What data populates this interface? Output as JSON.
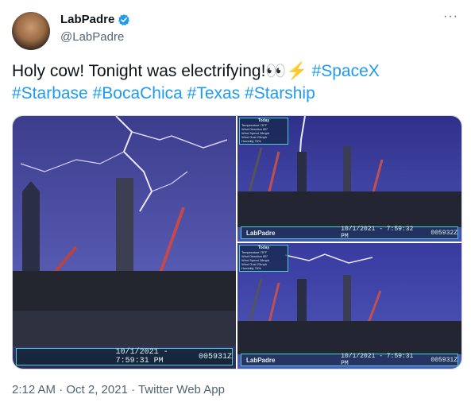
{
  "author": {
    "display_name": "LabPadre",
    "handle": "@LabPadre",
    "verified_icon": "verified-badge-icon",
    "avatar_icon": "avatar"
  },
  "menu": {
    "more_label": "···"
  },
  "tweet": {
    "text_plain": "Holy cow! Tonight was electrifying!",
    "emoji": "👀⚡",
    "hashtags": [
      "#SpaceX",
      "#Starbase",
      "#BocaChica",
      "#Texas",
      "#Starship"
    ]
  },
  "media": {
    "main": {
      "timestamp": "10/1/2021 - 7:59:31 PM",
      "code": "005931Z"
    },
    "top_right": {
      "logo": "LabPadre",
      "timestamp": "10/1/2021 - 7:59:32 PM",
      "code": "005932Z",
      "weather_title": "Today",
      "weather_lines": [
        "Temperature 75°F",
        "Wind Direction 85°",
        "Wind Speed 18mph",
        "Wind Gust 23mph",
        "Humidity 76%"
      ]
    },
    "bottom_right": {
      "logo": "LabPadre",
      "timestamp": "10/1/2021 - 7:59:31 PM",
      "code": "005931Z",
      "weather_title": "Today",
      "weather_lines": [
        "Temperature 75°F",
        "Wind Direction 85°",
        "Wind Speed 18mph",
        "Wind Gust 23mph",
        "Humidity 76%"
      ]
    }
  },
  "footer": {
    "timestamp": "2:12 AM · Oct 2, 2021 · Twitter Web App"
  },
  "colors": {
    "hashtag": "#1d9bf0",
    "verified": "#1d9bf0",
    "hud_border": "#4ad0d0"
  }
}
